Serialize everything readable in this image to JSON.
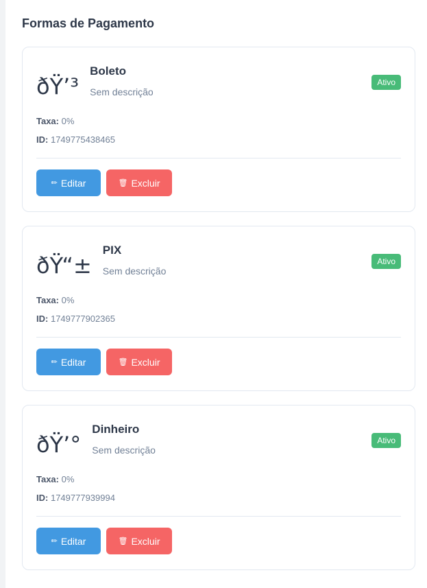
{
  "section": {
    "title": "Formas de Pagamento"
  },
  "labels": {
    "taxa": "Taxa:",
    "id": "ID:",
    "edit": "Editar",
    "delete": "Excluir"
  },
  "icons": {
    "edit": "pencil-icon",
    "delete": "trash-icon"
  },
  "colors": {
    "active_badge": "#48bb78",
    "edit_button": "#4299e1",
    "delete_button": "#f56565"
  },
  "methods": [
    {
      "icon": "ðŸ’³",
      "name": "Boleto",
      "description": "Sem descrição",
      "status": "Ativo",
      "taxa": "0%",
      "id": "1749775438465"
    },
    {
      "icon": "ðŸ“±",
      "name": "PIX",
      "description": "Sem descrição",
      "status": "Ativo",
      "taxa": "0%",
      "id": "1749777902365"
    },
    {
      "icon": "ðŸ’°",
      "name": "Dinheiro",
      "description": "Sem descrição",
      "status": "Ativo",
      "taxa": "0%",
      "id": "1749777939994"
    }
  ]
}
